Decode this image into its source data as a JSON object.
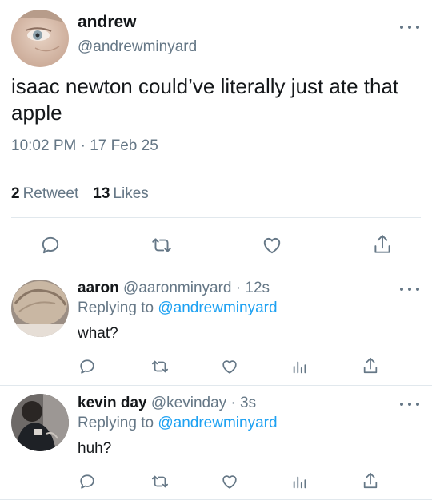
{
  "main_tweet": {
    "display_name": "andrew",
    "handle": "@andrewminyard",
    "text": "isaac newton could’ve literally just ate that apple",
    "timestamp": "10:02 PM · 17 Feb 25",
    "retweets_count": "2",
    "retweets_label": "Retweet",
    "likes_count": "13",
    "likes_label": "Likes",
    "actions": [
      "reply-icon",
      "retweet-icon",
      "like-icon",
      "share-icon"
    ]
  },
  "replies": [
    {
      "display_name": "aaron",
      "handle": "@aaronminyard",
      "age": "· 12s",
      "replying_prefix": "Replying to",
      "replying_to": "@andrewminyard",
      "text": "what?",
      "actions": [
        "reply-icon",
        "retweet-icon",
        "like-icon",
        "analytics-icon",
        "share-icon"
      ]
    },
    {
      "display_name": "kevin day",
      "handle": "@kevinday",
      "age": "· 3s",
      "replying_prefix": "Replying to",
      "replying_to": "@andrewminyard",
      "text": "huh?",
      "actions": [
        "reply-icon",
        "retweet-icon",
        "like-icon",
        "analytics-icon",
        "share-icon"
      ]
    }
  ],
  "colors": {
    "link": "#1da1f2",
    "secondary_text": "#657786",
    "primary_text": "#14171a",
    "divider": "#e1e8ed"
  }
}
